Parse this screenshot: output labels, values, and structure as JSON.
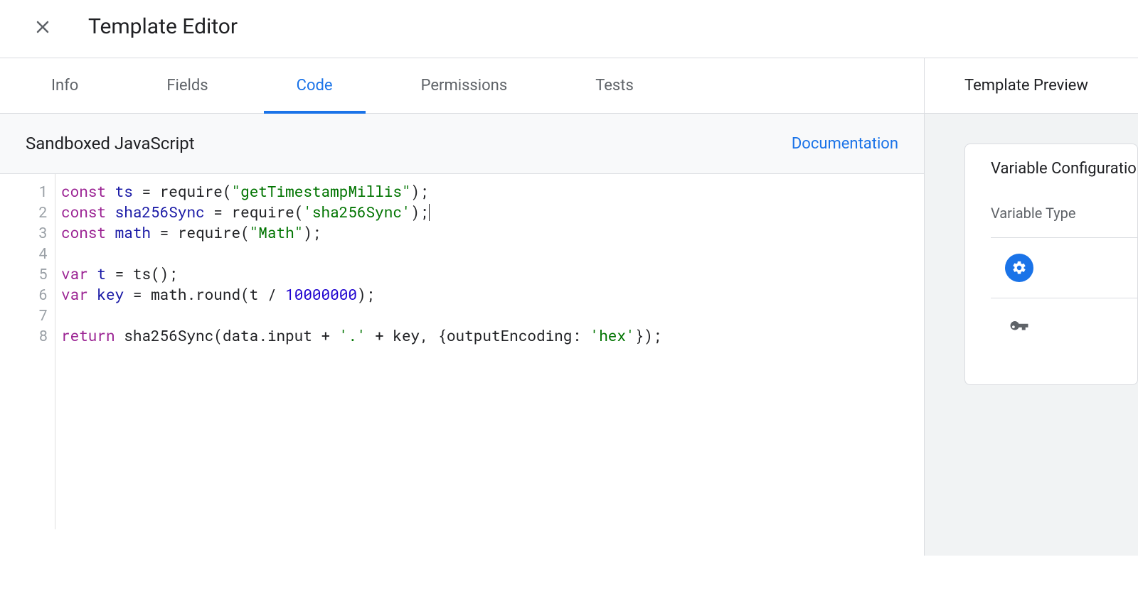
{
  "header": {
    "title": "Template Editor"
  },
  "tabs": [
    {
      "label": "Info",
      "active": false
    },
    {
      "label": "Fields",
      "active": false
    },
    {
      "label": "Code",
      "active": true
    },
    {
      "label": "Permissions",
      "active": false
    },
    {
      "label": "Tests",
      "active": false
    }
  ],
  "section": {
    "title": "Sandboxed JavaScript",
    "documentation_label": "Documentation"
  },
  "code": {
    "lines": [
      {
        "n": 1,
        "tokens": [
          {
            "t": "kw",
            "v": "const"
          },
          {
            "t": "txt",
            "v": " "
          },
          {
            "t": "ident",
            "v": "ts"
          },
          {
            "t": "txt",
            "v": " "
          },
          {
            "t": "pun",
            "v": "="
          },
          {
            "t": "txt",
            "v": " "
          },
          {
            "t": "txt",
            "v": "require"
          },
          {
            "t": "pun",
            "v": "("
          },
          {
            "t": "str",
            "v": "\"getTimestampMillis\""
          },
          {
            "t": "pun",
            "v": ");"
          }
        ]
      },
      {
        "n": 2,
        "tokens": [
          {
            "t": "kw",
            "v": "const"
          },
          {
            "t": "txt",
            "v": " "
          },
          {
            "t": "ident",
            "v": "sha256Sync"
          },
          {
            "t": "txt",
            "v": " "
          },
          {
            "t": "pun",
            "v": "="
          },
          {
            "t": "txt",
            "v": " "
          },
          {
            "t": "txt",
            "v": "require"
          },
          {
            "t": "pun",
            "v": "("
          },
          {
            "t": "str",
            "v": "'sha256Sync'"
          },
          {
            "t": "pun",
            "v": ");"
          },
          {
            "t": "cursor",
            "v": ""
          }
        ]
      },
      {
        "n": 3,
        "tokens": [
          {
            "t": "kw",
            "v": "const"
          },
          {
            "t": "txt",
            "v": " "
          },
          {
            "t": "ident",
            "v": "math"
          },
          {
            "t": "txt",
            "v": " "
          },
          {
            "t": "pun",
            "v": "="
          },
          {
            "t": "txt",
            "v": " "
          },
          {
            "t": "txt",
            "v": "require"
          },
          {
            "t": "pun",
            "v": "("
          },
          {
            "t": "str",
            "v": "\"Math\""
          },
          {
            "t": "pun",
            "v": ");"
          }
        ]
      },
      {
        "n": 4,
        "tokens": []
      },
      {
        "n": 5,
        "tokens": [
          {
            "t": "kw",
            "v": "var"
          },
          {
            "t": "txt",
            "v": " "
          },
          {
            "t": "ident",
            "v": "t"
          },
          {
            "t": "txt",
            "v": " "
          },
          {
            "t": "pun",
            "v": "="
          },
          {
            "t": "txt",
            "v": " "
          },
          {
            "t": "txt",
            "v": "ts"
          },
          {
            "t": "pun",
            "v": "();"
          }
        ]
      },
      {
        "n": 6,
        "tokens": [
          {
            "t": "kw",
            "v": "var"
          },
          {
            "t": "txt",
            "v": " "
          },
          {
            "t": "ident",
            "v": "key"
          },
          {
            "t": "txt",
            "v": " "
          },
          {
            "t": "pun",
            "v": "="
          },
          {
            "t": "txt",
            "v": " "
          },
          {
            "t": "txt",
            "v": "math.round(t "
          },
          {
            "t": "pun",
            "v": "/"
          },
          {
            "t": "txt",
            "v": " "
          },
          {
            "t": "num",
            "v": "10000000"
          },
          {
            "t": "pun",
            "v": ");"
          }
        ]
      },
      {
        "n": 7,
        "tokens": []
      },
      {
        "n": 8,
        "tokens": [
          {
            "t": "kw",
            "v": "return"
          },
          {
            "t": "txt",
            "v": " "
          },
          {
            "t": "txt",
            "v": "sha256Sync(data.input "
          },
          {
            "t": "pun",
            "v": "+"
          },
          {
            "t": "txt",
            "v": " "
          },
          {
            "t": "str",
            "v": "'.'"
          },
          {
            "t": "txt",
            "v": " "
          },
          {
            "t": "pun",
            "v": "+"
          },
          {
            "t": "txt",
            "v": " "
          },
          {
            "t": "txt",
            "v": "key, {outputEncoding: "
          },
          {
            "t": "str",
            "v": "'hex'"
          },
          {
            "t": "pun",
            "v": "});"
          }
        ]
      }
    ]
  },
  "preview": {
    "heading": "Template Preview",
    "card_title": "Variable Configuration",
    "type_label": "Variable Type"
  }
}
